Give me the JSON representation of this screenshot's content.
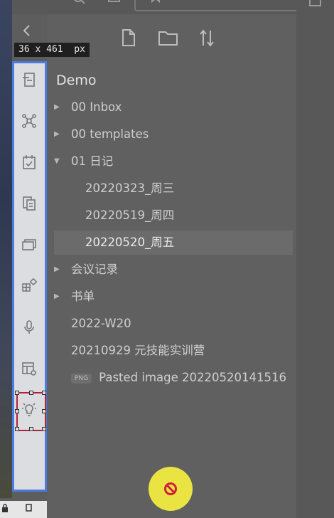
{
  "overlay": {
    "dimensions_label": "36 x 461  px"
  },
  "file_explorer": {
    "vault_name": "Demo",
    "items": [
      {
        "label": "00 Inbox",
        "type": "folder",
        "expanded": false
      },
      {
        "label": "00 templates",
        "type": "folder",
        "expanded": false
      },
      {
        "label": "01 日记",
        "type": "folder",
        "expanded": true
      },
      {
        "label": "20220323_周三",
        "type": "file"
      },
      {
        "label": "20220519_周四",
        "type": "file"
      },
      {
        "label": "20220520_周五",
        "type": "file",
        "selected": true
      },
      {
        "label": "会议记录",
        "type": "folder",
        "expanded": false
      },
      {
        "label": "书单",
        "type": "folder",
        "expanded": false
      },
      {
        "label": "2022-W20",
        "type": "file"
      },
      {
        "label": "20210929 元技能实训营",
        "type": "file"
      },
      {
        "label": "Pasted image 20220520141516",
        "type": "image",
        "badge": "PNG"
      }
    ]
  },
  "ribbon": {
    "icons": [
      "note-icon",
      "graph-icon",
      "daily-note-icon",
      "templates-icon",
      "slides-icon",
      "plugins-icon",
      "microphone-icon",
      "table-settings-icon",
      "lightbulb-icon"
    ]
  },
  "colors": {
    "accent_border": "#4a7be0",
    "selection_box": "#b4213a",
    "fab": "#e9e441",
    "fab_icon": "#d0203a"
  }
}
